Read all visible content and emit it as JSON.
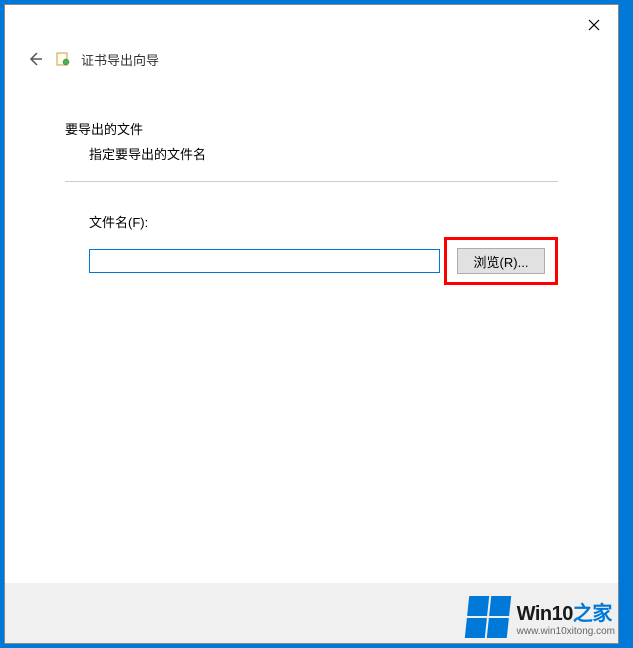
{
  "window": {
    "title": "证书导出向导"
  },
  "section": {
    "heading": "要导出的文件",
    "sub": "指定要导出的文件名"
  },
  "form": {
    "file_label": "文件名(F):",
    "file_value": "",
    "browse_label": "浏览(R)..."
  },
  "watermark": {
    "brand_prefix": "Win10",
    "brand_suffix": "之家",
    "url": "www.win10xitong.com"
  }
}
